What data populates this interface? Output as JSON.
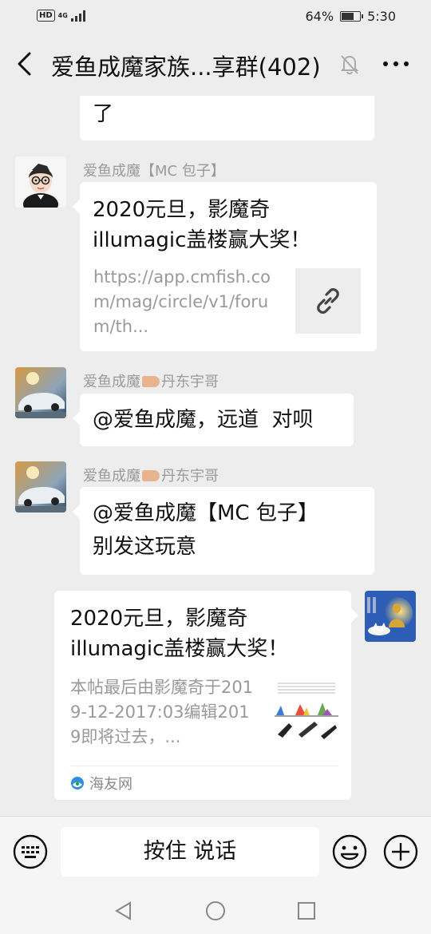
{
  "status_bar": {
    "hd": "HD",
    "network": "4G",
    "battery": "64%",
    "battery_level": 0.64,
    "time": "5:30"
  },
  "header": {
    "title": "爱鱼成魔家族...享群(402)"
  },
  "messages": [
    {
      "id": "m0",
      "text": "了"
    },
    {
      "id": "m1",
      "sender": "爱鱼成魔【MC 包子】",
      "type": "link",
      "title": "2020元旦，影魔奇illumagic盖楼赢大奖！",
      "desc": "https://app.cmfish.com/mag/circle/v1/forum/th..."
    },
    {
      "id": "m2",
      "sender_prefix": "爱鱼成魔",
      "sender_suffix": "丹东宇哥",
      "text": "@爱鱼成魔，远道  对呗"
    },
    {
      "id": "m3",
      "sender_prefix": "爱鱼成魔",
      "sender_suffix": "丹东宇哥",
      "text_line1": "@爱鱼成魔【MC 包子】",
      "text_line2": "别发这玩意"
    },
    {
      "id": "m4",
      "type": "link",
      "title": "2020元旦，影魔奇illumagic盖楼赢大奖！",
      "desc": "本帖最后由影魔奇于2019-12-2017:03编辑2019即将过去，...",
      "source": "海友网"
    }
  ],
  "input_bar": {
    "voice_label": "按住 说话"
  },
  "icons": {
    "back": "back-arrow-icon",
    "mute": "bell-off-icon",
    "more": "more-dots-icon",
    "link": "link-icon",
    "keyboard": "keyboard-icon",
    "emoji": "emoji-icon",
    "plus": "plus-icon"
  },
  "colors": {
    "background": "#ededed",
    "bubble": "#ffffff",
    "name": "#9a9a9a",
    "desc": "#999999"
  }
}
